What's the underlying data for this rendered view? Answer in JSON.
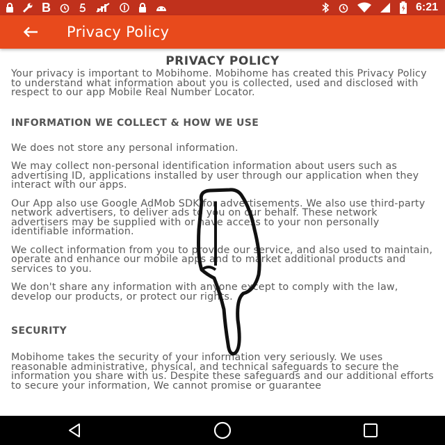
{
  "status_bar": {
    "time": "6:21",
    "b_label": "B",
    "icons_left": [
      "lock-icon",
      "wrench-icon",
      "b-icon",
      "alarm-icon",
      "five-icon",
      "no-signal-icon",
      "block-icon",
      "lock-icon",
      "android-icon"
    ],
    "icons_right": [
      "bluetooth-icon",
      "alarm-icon",
      "wifi-icon",
      "signal-icon",
      "battery-icon"
    ]
  },
  "app_bar": {
    "title": "Privacy Policy",
    "background": "#e84a1c"
  },
  "document": {
    "title": "PRIVACY POLICY",
    "intro": "Your privacy is important to Mobihome. Mobihome has created this Privacy Policy to understand what information about you is collected, used and disclosed with respect to our app Mobile Real Number Locator.",
    "section1_heading": "INFORMATION WE COLLECT & HOW WE USE",
    "section1_paragraphs": [
      "We does not store any personal information.",
      "We may collect non-personal identification information about users such as advertising ID, applications installed by user through our application when they interact with our apps.",
      "Our App also use Google AdMob SDK for advertisements. We also use third-party network advertisers, to deliver ads to you on our behalf. These network advertisers may be supplied with or have access to your non personally identifiable information.",
      "We  collect information from you to provide our service, and also used to maintain, operate and enhance our mobile apps and to market additional products and services to you.",
      "We don't share any information with anyone except to comply with the law, develop our products, or protect our rights."
    ],
    "section2_heading": "SECURITY",
    "section2_paragraphs": [
      "Mobihome takes the security of your information very seriously. We uses reasonable administrative, physical, and technical safeguards to secure the information you share with us. Despite these safeguards and our additional efforts to secure your information, We cannot promise or guarantee"
    ]
  },
  "nav_bar": {
    "buttons": [
      "back-triangle-icon",
      "home-circle-icon",
      "recents-square-icon"
    ]
  }
}
